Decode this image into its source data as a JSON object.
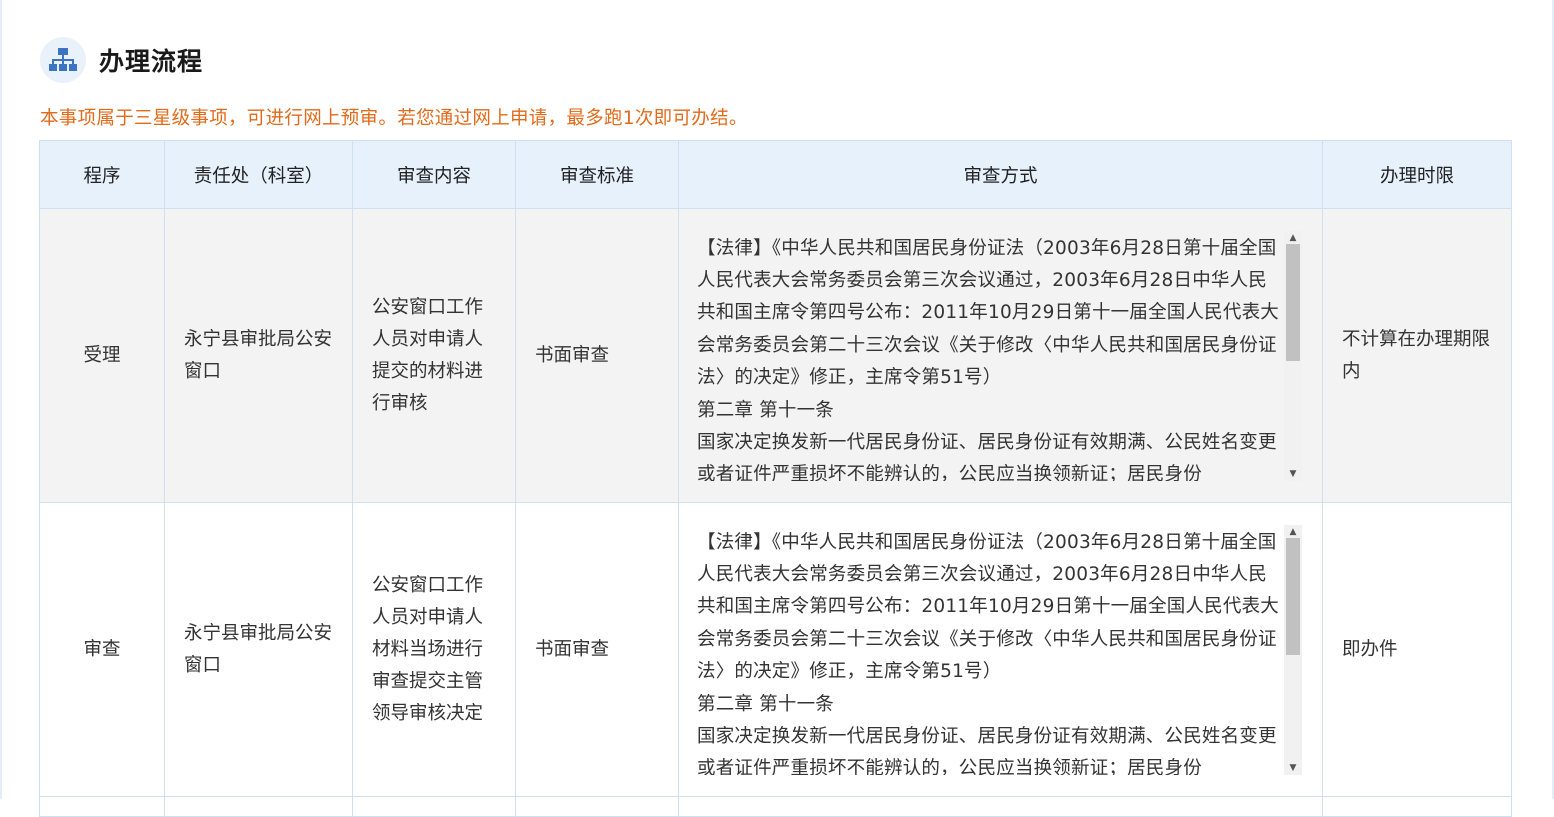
{
  "section": {
    "icon": "sitemap-icon",
    "title": "办理流程"
  },
  "notice": "本事项属于三星级事项，可进行网上预审。若您通过网上申请，最多跑1次即可办结。",
  "colors": {
    "accent": "#3b74c0",
    "notice": "#e26a1b",
    "header_bg": "#e7f1fc",
    "border": "#cfe0f1",
    "row_alt_bg": "#f3f3f3"
  },
  "table": {
    "headers": [
      "程序",
      "责任处（科室）",
      "审查内容",
      "审查标准",
      "审查方式",
      "办理时限"
    ],
    "rows": [
      {
        "step": "受理",
        "department": "永宁县审批局公安窗口",
        "content": "公安窗口工作人员对申请人提交的材料进行审核",
        "standard": "书面审查",
        "method": [
          "【法律】《中华人民共和国居民身份证法（2003年6月28日第十届全国人民代表大会常务委员会第三次会议通过，2003年6月28日中华人民共和国主席令第四号公布：2011年10月29日第十一届全国人民代表大会常务委员会第二十三次会议《关于修改〈中华人民共和国居民身份证法〉的决定》修正，主席令第51号）",
          "第二章 第十一条",
          "国家决定换发新一代居民身份证、居民身份证有效期满、公民姓名变更或者证件严重损坏不能辨认的，公民应当换领新证；居民身份"
        ],
        "time_limit": "不计算在办理期限内"
      },
      {
        "step": "审查",
        "department": "永宁县审批局公安窗口",
        "content": "公安窗口工作人员对申请人材料当场进行审查提交主管领导审核决定",
        "standard": "书面审查",
        "method": [
          "【法律】《中华人民共和国居民身份证法（2003年6月28日第十届全国人民代表大会常务委员会第三次会议通过，2003年6月28日中华人民共和国主席令第四号公布：2011年10月29日第十一届全国人民代表大会常务委员会第二十三次会议《关于修改〈中华人民共和国居民身份证法〉的决定》修正，主席令第51号）",
          "第二章 第十一条",
          "国家决定换发新一代居民身份证、居民身份证有效期满、公民姓名变更或者证件严重损坏不能辨认的，公民应当换领新证；居民身份"
        ],
        "time_limit": "即办件"
      }
    ]
  }
}
